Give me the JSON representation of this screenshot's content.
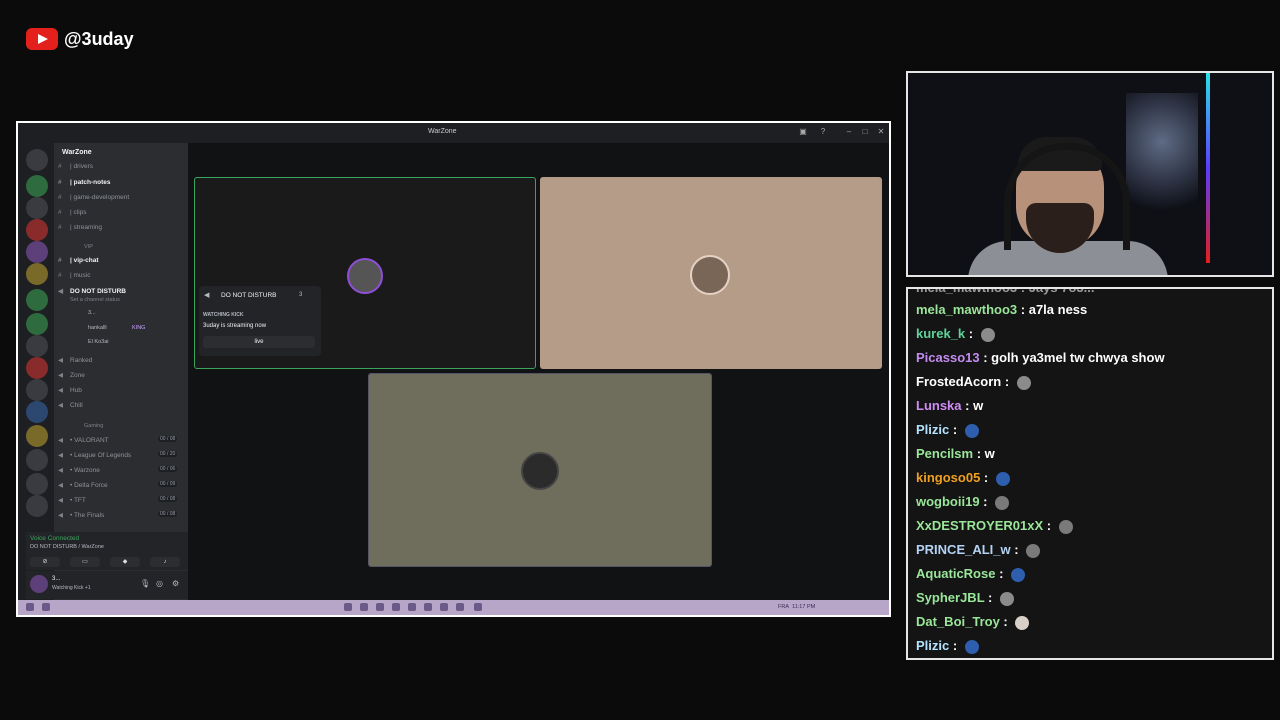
{
  "brand": {
    "handle": "@3uday"
  },
  "discord": {
    "window_title": "WarZone",
    "guild_name": "WarZone",
    "channels": [
      {
        "name": "| drivers",
        "type": "text",
        "bold": false
      },
      {
        "name": "| patch-notes",
        "type": "text",
        "bold": true
      },
      {
        "name": "| game-development",
        "type": "text",
        "bold": false
      },
      {
        "name": "| clips",
        "type": "text",
        "bold": false
      },
      {
        "name": "| streaming",
        "type": "text",
        "bold": false
      }
    ],
    "category_vip": "VIP",
    "vip_channels": [
      {
        "name": "| vip-chat",
        "type": "text",
        "bold": true
      },
      {
        "name": "| music",
        "type": "text",
        "bold": false
      }
    ],
    "active_voice": {
      "name": "DO NOT DISTURB",
      "status": "Set a channel status"
    },
    "voice_users": [
      {
        "name": "3...",
        "tag": ""
      },
      {
        "name": "hankalll",
        "tag": "KING"
      },
      {
        "name": "El Ko3ai",
        "tag": ""
      }
    ],
    "voice_channels": [
      "Ranked",
      "Zone",
      "Hub",
      "Chill"
    ],
    "category_gaming": "Gaming",
    "gaming_channels": [
      {
        "name": "• VALORANT",
        "count": "00 / 08"
      },
      {
        "name": "• League Of Legends",
        "count": "00 / 20"
      },
      {
        "name": "• Warzone",
        "count": "00 / 06"
      },
      {
        "name": "• Delta Force",
        "count": "00 / 09"
      },
      {
        "name": "• TFT",
        "count": "00 / 08"
      },
      {
        "name": "• The Finals",
        "count": "00 / 08"
      }
    ],
    "voice_panel": {
      "label": "Voice Connected",
      "sub": "DO NOT DISTURB / WarZone"
    },
    "user": {
      "name": "3...",
      "status": "Watching Kick +1"
    },
    "popout": {
      "title": "DO NOT DISTURB",
      "count": "3",
      "label": "WATCHING KICK",
      "message": "3uday is streaming now",
      "button": "live"
    },
    "taskbar": {
      "lang": "FRA",
      "time": "11:17 PM"
    }
  },
  "chat": {
    "cut_top": "mela_mawthoo3 : Jays 7o3...",
    "messages": [
      {
        "user": "mela_mawthoo3",
        "color": "#9ae69a",
        "text": "a7la ness",
        "emote": ""
      },
      {
        "user": "kurek_k",
        "color": "#5fd39b",
        "text": "",
        "emote": "#8b8b8b"
      },
      {
        "user": "Picasso13",
        "color": "#c38cf2",
        "text": "golh ya3mel tw chwya show",
        "emote": ""
      },
      {
        "user": "FrostedAcorn",
        "color": "#ffffff",
        "text": "",
        "emote": "#8b8b8b"
      },
      {
        "user": "Lunska",
        "color": "#d08cf5",
        "text": "w",
        "emote": ""
      },
      {
        "user": "Plizic",
        "color": "#b5e3ff",
        "text": "",
        "emote": "#2d5fae"
      },
      {
        "user": "Pencilsm",
        "color": "#9ae69a",
        "text": "w",
        "emote": ""
      },
      {
        "user": "kingoso05",
        "color": "#f0a020",
        "text": "",
        "emote": "#2d5fae"
      },
      {
        "user": "wogboii19",
        "color": "#9ae69a",
        "text": "",
        "emote": "#7a7a7a"
      },
      {
        "user": "XxDESTROYER01xX",
        "color": "#9ae69a",
        "text": "",
        "emote": "#7a7a7a"
      },
      {
        "user": "PRINCE_ALI_w",
        "color": "#b5d3f5",
        "text": "",
        "emote": "#7a7a7a"
      },
      {
        "user": "AquaticRose",
        "color": "#9ae69a",
        "text": "",
        "emote": "#2d5fae"
      },
      {
        "user": "SypherJBL",
        "color": "#9ae69a",
        "text": "",
        "emote": "#8b8b8b"
      },
      {
        "user": "Dat_Boi_Troy",
        "color": "#9ae69a",
        "text": "",
        "emote": "#d8d0c8"
      },
      {
        "user": "Plizic",
        "color": "#b5e3ff",
        "text": "",
        "emote": "#2d5fae"
      }
    ]
  },
  "colors": {
    "accent": "#3ba55d",
    "youtube": "#e3201b",
    "taskbar": "#b7a6c8"
  }
}
